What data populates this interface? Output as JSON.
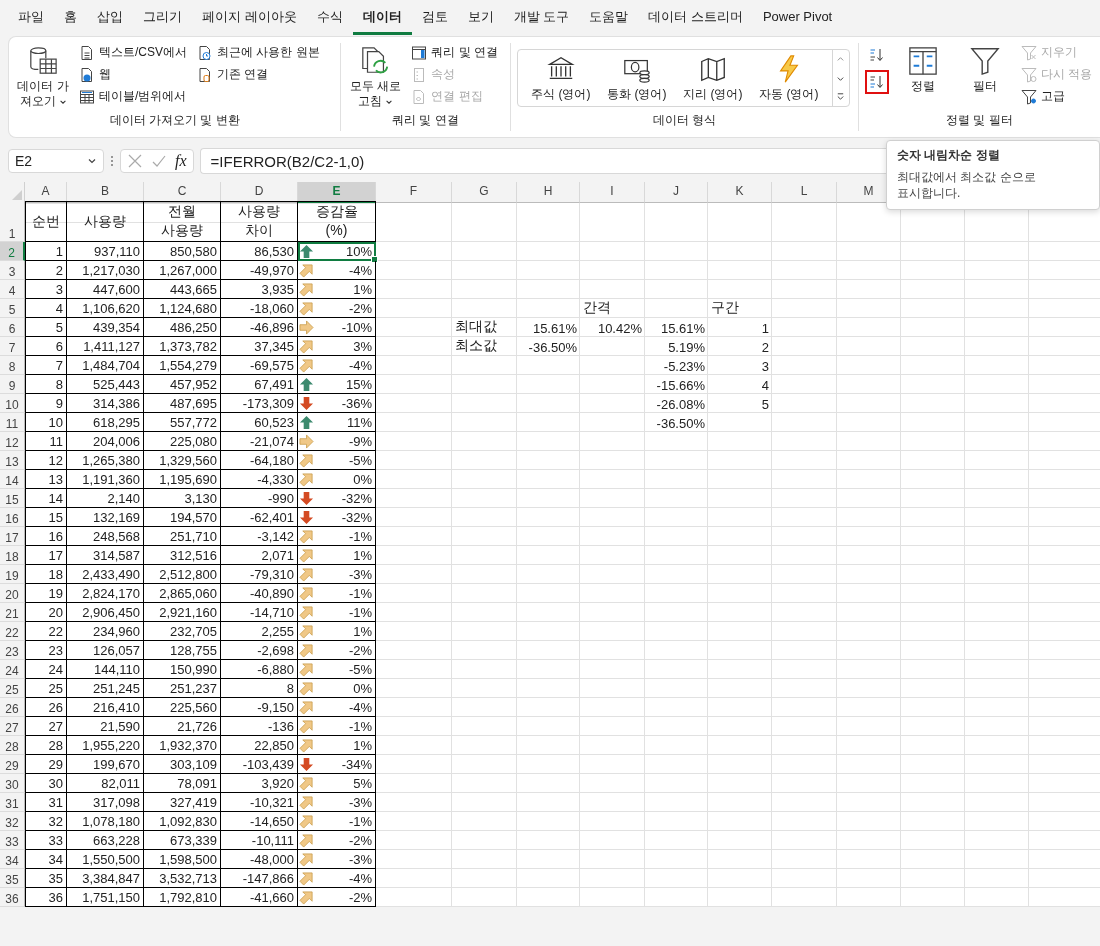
{
  "tabs": [
    {
      "label": "파일",
      "selected": false
    },
    {
      "label": "홈",
      "selected": false
    },
    {
      "label": "삽입",
      "selected": false
    },
    {
      "label": "그리기",
      "selected": false
    },
    {
      "label": "페이지 레이아웃",
      "selected": false
    },
    {
      "label": "수식",
      "selected": false
    },
    {
      "label": "데이터",
      "selected": true
    },
    {
      "label": "검토",
      "selected": false
    },
    {
      "label": "보기",
      "selected": false
    },
    {
      "label": "개발 도구",
      "selected": false
    },
    {
      "label": "도움말",
      "selected": false
    },
    {
      "label": "데이터 스트리머",
      "selected": false
    },
    {
      "label": "Power Pivot",
      "selected": false
    }
  ],
  "ribbon": {
    "groups": [
      {
        "title": "데이터 가져오기 및 변환",
        "columns": [
          [
            {
              "kind": "large",
              "label": "데이터 가져오기",
              "dropdown": true,
              "disabled": false
            }
          ],
          [
            {
              "kind": "small",
              "label": "텍스트/CSV에서",
              "disabled": false
            },
            {
              "kind": "small",
              "label": "웹",
              "disabled": false
            },
            {
              "kind": "small",
              "label": "테이블/범위에서",
              "disabled": false
            }
          ],
          [
            {
              "kind": "small",
              "label": "최근에 사용한 원본",
              "disabled": false
            },
            {
              "kind": "small",
              "label": "기존 연결",
              "disabled": false
            }
          ]
        ]
      },
      {
        "title": "쿼리 및 연결",
        "columns": [
          [
            {
              "kind": "large",
              "label": "모두 새로 고침",
              "dropdown": true,
              "disabled": false
            }
          ],
          [
            {
              "kind": "small",
              "label": "쿼리 및 연결",
              "disabled": false
            },
            {
              "kind": "small",
              "label": "속성",
              "disabled": true
            },
            {
              "kind": "small",
              "label": "연결 편집",
              "disabled": true
            }
          ]
        ]
      },
      {
        "title": "데이터 형식",
        "columns": [
          [
            {
              "kind": "gallery",
              "options": [
                {
                  "label": "주식 (영어)"
                },
                {
                  "label": "통화 (영어)"
                },
                {
                  "label": "지리 (영어)"
                },
                {
                  "label": "자동 (영어)"
                }
              ]
            }
          ]
        ]
      },
      {
        "title": "정렬 및 필터",
        "columns": [
          [
            {
              "kind": "icon",
              "highlighted": false
            },
            {
              "kind": "icon",
              "highlighted": true
            }
          ],
          [
            {
              "kind": "large",
              "label": "정렬",
              "disabled": false
            }
          ],
          [
            {
              "kind": "large",
              "label": "필터",
              "disabled": false
            }
          ],
          [
            {
              "kind": "small",
              "label": "지우기",
              "disabled": true
            },
            {
              "kind": "small",
              "label": "다시 적용",
              "disabled": true
            },
            {
              "kind": "small",
              "label": "고급",
              "disabled": false
            }
          ]
        ]
      }
    ]
  },
  "tooltip": {
    "title": "숫자 내림차순 정렬",
    "body_lines": [
      "최대값에서 최소값 순으로",
      "표시합니다."
    ]
  },
  "formula_bar": {
    "name_box": "E2",
    "function_label": "fx",
    "formula": "=IFERROR(B2/C2-1,0)"
  },
  "sheet": {
    "columns": [
      {
        "label": "A",
        "selected": false
      },
      {
        "label": "B",
        "selected": false
      },
      {
        "label": "C",
        "selected": false
      },
      {
        "label": "D",
        "selected": false
      },
      {
        "label": "E",
        "selected": true
      },
      {
        "label": "F",
        "selected": false
      },
      {
        "label": "G",
        "selected": false
      },
      {
        "label": "H",
        "selected": false
      },
      {
        "label": "I",
        "selected": false
      },
      {
        "label": "J",
        "selected": false
      },
      {
        "label": "K",
        "selected": false
      },
      {
        "label": "L",
        "selected": false
      },
      {
        "label": "M",
        "selected": false
      }
    ],
    "header": {
      "n": "1",
      "cells": [
        "순번",
        "사용량",
        "전월\n사용량",
        "사용량\n차이",
        "증감율\n(%)"
      ]
    },
    "rows": [
      {
        "n": "2",
        "a": "1",
        "b": "937,110",
        "c": "850,580",
        "d": "86,530",
        "kind": "up",
        "e": "10%",
        "selected": true
      },
      {
        "n": "3",
        "a": "2",
        "b": "1,217,030",
        "c": "1,267,000",
        "d": "-49,970",
        "kind": "up-right",
        "e": "-4%",
        "selected": false
      },
      {
        "n": "4",
        "a": "3",
        "b": "447,600",
        "c": "443,665",
        "d": "3,935",
        "kind": "up-right",
        "e": "1%",
        "selected": false
      },
      {
        "n": "5",
        "a": "4",
        "b": "1,106,620",
        "c": "1,124,680",
        "d": "-18,060",
        "kind": "up-right",
        "e": "-2%",
        "selected": false,
        "side": {
          "i": {
            "text": "간격",
            "kind": "label"
          },
          "k": {
            "text": "구간",
            "kind": "label"
          }
        }
      },
      {
        "n": "6",
        "a": "5",
        "b": "439,354",
        "c": "486,250",
        "d": "-46,896",
        "kind": "right",
        "e": "-10%",
        "selected": false,
        "side": {
          "g": {
            "text": "최대값",
            "kind": "label"
          },
          "h": {
            "text": "15.61%",
            "kind": "number"
          },
          "i": {
            "text": "10.42%",
            "kind": "number"
          },
          "j": {
            "text": "15.61%",
            "kind": "number"
          },
          "k": {
            "text": "1",
            "kind": "number"
          }
        }
      },
      {
        "n": "7",
        "a": "6",
        "b": "1,411,127",
        "c": "1,373,782",
        "d": "37,345",
        "kind": "up-right",
        "e": "3%",
        "selected": false,
        "side": {
          "g": {
            "text": "최소값",
            "kind": "label"
          },
          "h": {
            "text": "-36.50%",
            "kind": "number"
          },
          "j": {
            "text": "5.19%",
            "kind": "number"
          },
          "k": {
            "text": "2",
            "kind": "number"
          }
        }
      },
      {
        "n": "8",
        "a": "7",
        "b": "1,484,704",
        "c": "1,554,279",
        "d": "-69,575",
        "kind": "up-right",
        "e": "-4%",
        "selected": false,
        "side": {
          "j": {
            "text": "-5.23%",
            "kind": "number"
          },
          "k": {
            "text": "3",
            "kind": "number"
          }
        }
      },
      {
        "n": "9",
        "a": "8",
        "b": "525,443",
        "c": "457,952",
        "d": "67,491",
        "kind": "up",
        "e": "15%",
        "selected": false,
        "side": {
          "j": {
            "text": "-15.66%",
            "kind": "number"
          },
          "k": {
            "text": "4",
            "kind": "number"
          }
        }
      },
      {
        "n": "10",
        "a": "9",
        "b": "314,386",
        "c": "487,695",
        "d": "-173,309",
        "kind": "down",
        "e": "-36%",
        "selected": false,
        "side": {
          "j": {
            "text": "-26.08%",
            "kind": "number"
          },
          "k": {
            "text": "5",
            "kind": "number"
          }
        }
      },
      {
        "n": "11",
        "a": "10",
        "b": "618,295",
        "c": "557,772",
        "d": "60,523",
        "kind": "up",
        "e": "11%",
        "selected": false,
        "side": {
          "j": {
            "text": "-36.50%",
            "kind": "number"
          }
        }
      },
      {
        "n": "12",
        "a": "11",
        "b": "204,006",
        "c": "225,080",
        "d": "-21,074",
        "kind": "right",
        "e": "-9%",
        "selected": false
      },
      {
        "n": "13",
        "a": "12",
        "b": "1,265,380",
        "c": "1,329,560",
        "d": "-64,180",
        "kind": "up-right",
        "e": "-5%",
        "selected": false
      },
      {
        "n": "14",
        "a": "13",
        "b": "1,191,360",
        "c": "1,195,690",
        "d": "-4,330",
        "kind": "up-right",
        "e": "0%",
        "selected": false
      },
      {
        "n": "15",
        "a": "14",
        "b": "2,140",
        "c": "3,130",
        "d": "-990",
        "kind": "down",
        "e": "-32%",
        "selected": false
      },
      {
        "n": "16",
        "a": "15",
        "b": "132,169",
        "c": "194,570",
        "d": "-62,401",
        "kind": "down",
        "e": "-32%",
        "selected": false
      },
      {
        "n": "17",
        "a": "16",
        "b": "248,568",
        "c": "251,710",
        "d": "-3,142",
        "kind": "up-right",
        "e": "-1%",
        "selected": false
      },
      {
        "n": "18",
        "a": "17",
        "b": "314,587",
        "c": "312,516",
        "d": "2,071",
        "kind": "up-right",
        "e": "1%",
        "selected": false
      },
      {
        "n": "19",
        "a": "18",
        "b": "2,433,490",
        "c": "2,512,800",
        "d": "-79,310",
        "kind": "up-right",
        "e": "-3%",
        "selected": false
      },
      {
        "n": "20",
        "a": "19",
        "b": "2,824,170",
        "c": "2,865,060",
        "d": "-40,890",
        "kind": "up-right",
        "e": "-1%",
        "selected": false
      },
      {
        "n": "21",
        "a": "20",
        "b": "2,906,450",
        "c": "2,921,160",
        "d": "-14,710",
        "kind": "up-right",
        "e": "-1%",
        "selected": false
      },
      {
        "n": "22",
        "a": "22",
        "b": "234,960",
        "c": "232,705",
        "d": "2,255",
        "kind": "up-right",
        "e": "1%",
        "selected": false
      },
      {
        "n": "23",
        "a": "23",
        "b": "126,057",
        "c": "128,755",
        "d": "-2,698",
        "kind": "up-right",
        "e": "-2%",
        "selected": false
      },
      {
        "n": "24",
        "a": "24",
        "b": "144,110",
        "c": "150,990",
        "d": "-6,880",
        "kind": "up-right",
        "e": "-5%",
        "selected": false
      },
      {
        "n": "25",
        "a": "25",
        "b": "251,245",
        "c": "251,237",
        "d": "8",
        "kind": "up-right",
        "e": "0%",
        "selected": false
      },
      {
        "n": "26",
        "a": "26",
        "b": "216,410",
        "c": "225,560",
        "d": "-9,150",
        "kind": "up-right",
        "e": "-4%",
        "selected": false
      },
      {
        "n": "27",
        "a": "27",
        "b": "21,590",
        "c": "21,726",
        "d": "-136",
        "kind": "up-right",
        "e": "-1%",
        "selected": false
      },
      {
        "n": "28",
        "a": "28",
        "b": "1,955,220",
        "c": "1,932,370",
        "d": "22,850",
        "kind": "up-right",
        "e": "1%",
        "selected": false
      },
      {
        "n": "29",
        "a": "29",
        "b": "199,670",
        "c": "303,109",
        "d": "-103,439",
        "kind": "down",
        "e": "-34%",
        "selected": false
      },
      {
        "n": "30",
        "a": "30",
        "b": "82,011",
        "c": "78,091",
        "d": "3,920",
        "kind": "up-right",
        "e": "5%",
        "selected": false
      },
      {
        "n": "31",
        "a": "31",
        "b": "317,098",
        "c": "327,419",
        "d": "-10,321",
        "kind": "up-right",
        "e": "-3%",
        "selected": false
      },
      {
        "n": "32",
        "a": "32",
        "b": "1,078,180",
        "c": "1,092,830",
        "d": "-14,650",
        "kind": "up-right",
        "e": "-1%",
        "selected": false
      },
      {
        "n": "33",
        "a": "33",
        "b": "663,228",
        "c": "673,339",
        "d": "-10,111",
        "kind": "up-right",
        "e": "-2%",
        "selected": false
      },
      {
        "n": "34",
        "a": "34",
        "b": "1,550,500",
        "c": "1,598,500",
        "d": "-48,000",
        "kind": "up-right",
        "e": "-3%",
        "selected": false
      },
      {
        "n": "35",
        "a": "35",
        "b": "3,384,847",
        "c": "3,532,713",
        "d": "-147,866",
        "kind": "up-right",
        "e": "-4%",
        "selected": false
      },
      {
        "n": "36",
        "a": "36",
        "b": "1,751,150",
        "c": "1,792,810",
        "d": "-41,660",
        "kind": "up-right",
        "e": "-2%",
        "selected": false
      }
    ]
  }
}
